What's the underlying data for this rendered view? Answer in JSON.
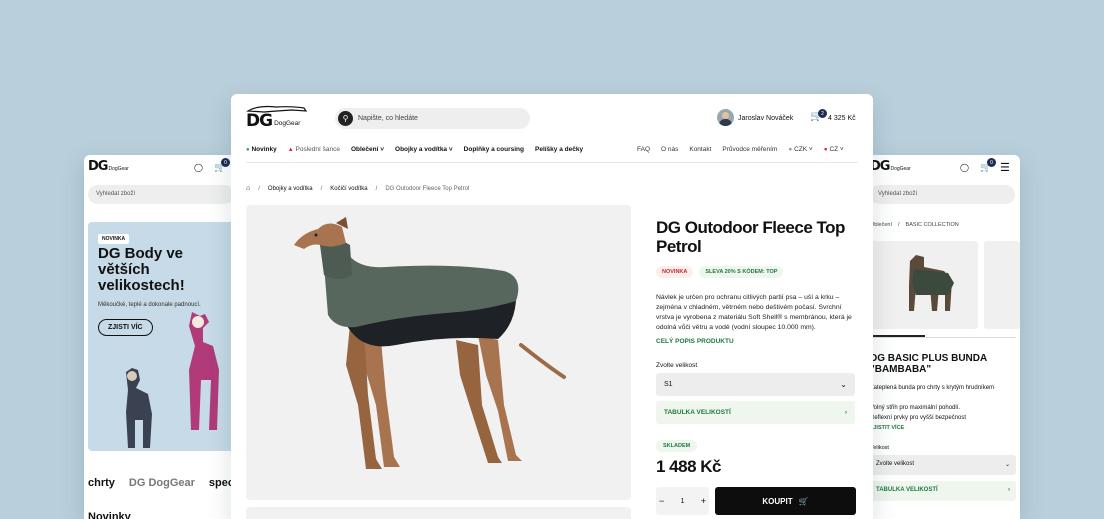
{
  "left_mobile": {
    "logo": "DG",
    "logo_sub": "DogGear",
    "cart_count": "0",
    "search_placeholder": "Vyhledat zboží",
    "hero": {
      "badge": "NOVINKA",
      "title": "DG Body ve větších velikostech!",
      "subtitle": "Měkoučké, teplé a dokonale padnoucí.",
      "cta": "ZJISTI VÍC"
    },
    "brands": [
      "chrty",
      "DG DogGear",
      "spec"
    ],
    "section_heading": "Novinky"
  },
  "main": {
    "logo": "DG",
    "logo_sub": "DogGear",
    "search_placeholder": "Napište, co hledáte",
    "user_name": "Jaroslav Nováček",
    "cart_count": "2",
    "cart_total": "4 325 Kč",
    "nav_left": [
      {
        "label": "Novinky",
        "marker": "green"
      },
      {
        "label": "Poslední šance",
        "marker": "red"
      },
      {
        "label": "Oblečení",
        "chevron": true
      },
      {
        "label": "Obojky a vodítka",
        "chevron": true
      },
      {
        "label": "Doplňky a coursing"
      },
      {
        "label": "Pelíšky a dečky"
      }
    ],
    "nav_right": [
      "FAQ",
      "O nás",
      "Kontakt",
      "Průvodce měřením"
    ],
    "currency": "CZK",
    "language": "CZ",
    "breadcrumb": [
      "Obojky a vodítka",
      "Kočičí vodítka",
      "DG Outodoor Fleece Top Petrol"
    ],
    "product": {
      "title": "DG Outodoor Fleece Top Petrol",
      "tag_new": "NOVINKA",
      "tag_discount": "SLEVA 20% S KÓDEM: TOP",
      "description": "Návlek je určen pro ochranu citlivých partií psa – uší a krku – zejména v chladném, větrném nebo deštivém počasí. Svrchní vrstva je vyrobena z materiálu Soft Shell® s membránou, která je odolná vůči větru a vodě (vodní sloupec 10.000 mm).",
      "full_desc_link": "CELÝ POPIS PRODUKTU",
      "size_label": "Zvolte velikost",
      "size_value": "S1",
      "size_table": "TABULKA VELIKOSTÍ",
      "stock": "SKLADEM",
      "price": "1 488 Kč",
      "qty": "1",
      "qty_minus": "−",
      "qty_plus": "+",
      "buy": "KOUPIT"
    }
  },
  "right_mobile": {
    "logo": "DG",
    "logo_sub": "DogGear",
    "cart_count": "0",
    "search_placeholder": "Vyhledat zboží",
    "breadcrumb": [
      "Oblečení",
      "BASIC COLLECTION"
    ],
    "title": "DG BASIC PLUS BUNDA \"BAMBABA\"",
    "subtitle": "Zateplená bunda pro chrty s krytým hrudníkem",
    "bullets": [
      "Volný střih pro maximální pohodlí.",
      "Reflexní prvky pro vyšší bezpečnost"
    ],
    "more_link": "ZJISTIT VÍCE",
    "size_label": "Velikost",
    "size_value": "Zvolte velikost",
    "size_table": "TABULKA VELIKOSTÍ"
  },
  "colors": {
    "background": "#b9cfdb",
    "accent_green": "#1f7a3f",
    "dark": "#111111",
    "tag_bg": "#eef6ee"
  }
}
